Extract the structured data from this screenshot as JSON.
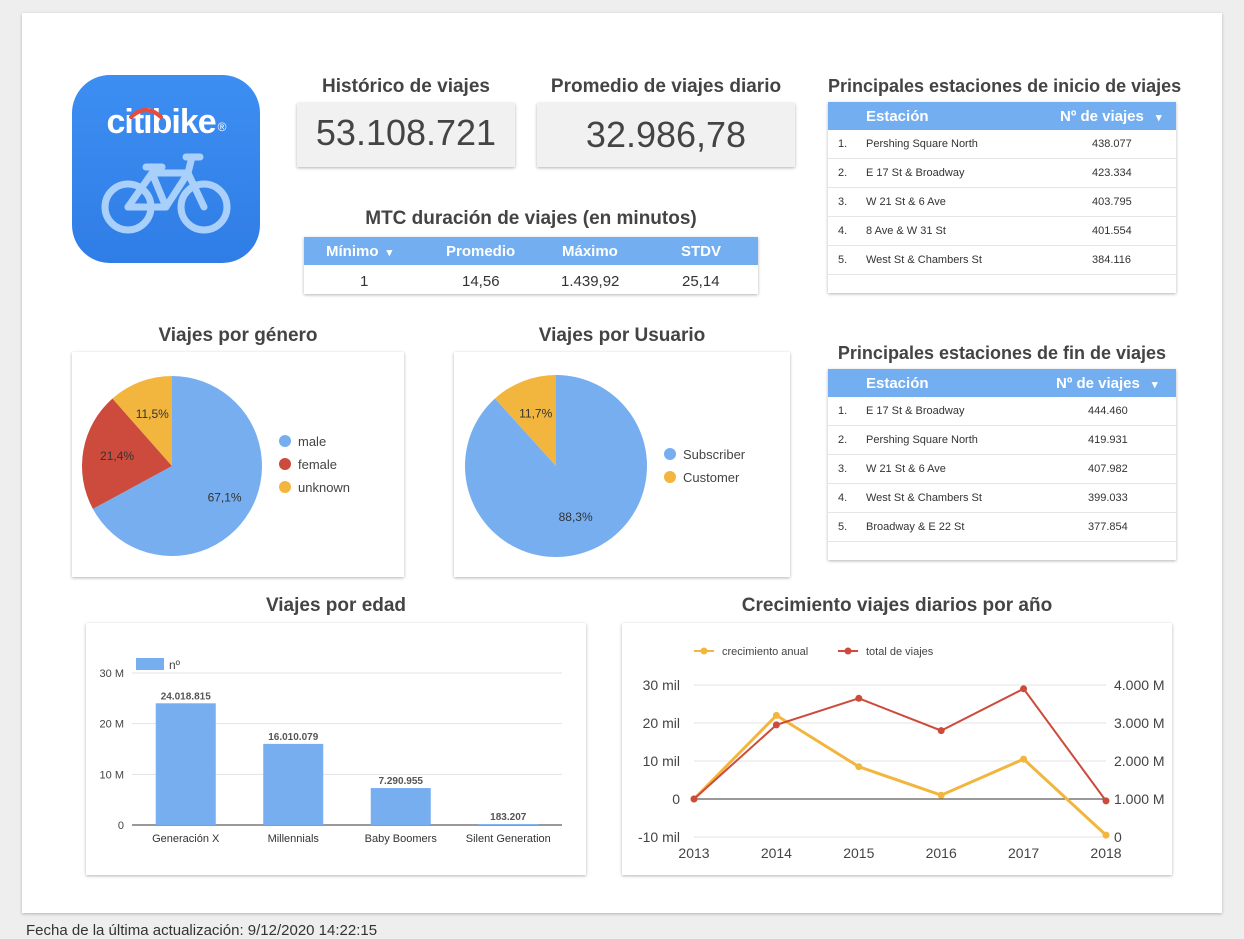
{
  "kpis": {
    "historico_title": "Histórico de viajes",
    "historico_value": "53.108.721",
    "promedio_title": "Promedio de viajes diario",
    "promedio_value": "32.986,78"
  },
  "logo": {
    "text_a": "citi",
    "text_b": "bike",
    "mark": "®"
  },
  "mtc": {
    "title": "MTC duración de viajes (en minutos)",
    "headers": [
      "Mínimo",
      "Promedio",
      "Máximo",
      "STDV"
    ],
    "sort_icon": "▾",
    "values": [
      "1",
      "14,56",
      "1.439,92",
      "25,14"
    ]
  },
  "inicio": {
    "title": "Principales estaciones de inicio de viajes",
    "col_station": "Estación",
    "col_trips": "Nº de viajes",
    "sort_icon": "▾",
    "rows": [
      {
        "rank": "1.",
        "station": "Pershing Square North",
        "trips": "438.077"
      },
      {
        "rank": "2.",
        "station": "E 17 St & Broadway",
        "trips": "423.334"
      },
      {
        "rank": "3.",
        "station": "W 21 St & 6 Ave",
        "trips": "403.795"
      },
      {
        "rank": "4.",
        "station": "8 Ave & W 31 St",
        "trips": "401.554"
      },
      {
        "rank": "5.",
        "station": "West St & Chambers St",
        "trips": "384.116"
      }
    ]
  },
  "fin": {
    "title": "Principales estaciones de fin de viajes",
    "col_station": "Estación",
    "col_trips": "Nº de viajes",
    "sort_icon": "▾",
    "rows": [
      {
        "rank": "1.",
        "station": "E 17 St & Broadway",
        "trips": "444.460"
      },
      {
        "rank": "2.",
        "station": "Pershing Square North",
        "trips": "419.931"
      },
      {
        "rank": "3.",
        "station": "W 21 St & 6 Ave",
        "trips": "407.982"
      },
      {
        "rank": "4.",
        "station": "West St & Chambers St",
        "trips": "399.033"
      },
      {
        "rank": "5.",
        "station": "Broadway & E 22 St",
        "trips": "377.854"
      }
    ]
  },
  "footer_text": "Fecha de la última actualización: 9/12/2020 14:22:15",
  "colors": {
    "blue": "#76aef0",
    "red": "#cc4b3c",
    "yellow": "#f2b63e",
    "header_blue": "#73aef0"
  },
  "chart_data": [
    {
      "type": "pie",
      "title": "Viajes por género",
      "labels": [
        "male",
        "female",
        "unknown"
      ],
      "values": [
        67.1,
        21.4,
        11.5
      ],
      "value_labels": [
        "67,1%",
        "21,4%",
        "11,5%"
      ],
      "colors": [
        "#76aef0",
        "#cc4b3c",
        "#f2b63e"
      ],
      "legend": "right"
    },
    {
      "type": "pie",
      "title": "Viajes por Usuario",
      "labels": [
        "Subscriber",
        "Customer"
      ],
      "values": [
        88.3,
        11.7
      ],
      "value_labels": [
        "88,3%",
        "11,7%"
      ],
      "colors": [
        "#76aef0",
        "#f2b63e"
      ],
      "legend": "right"
    },
    {
      "type": "bar",
      "title": "Viajes por edad",
      "categories": [
        "Generación X",
        "Millennials",
        "Baby Boomers",
        "Silent Generation"
      ],
      "series": [
        {
          "name": "nº",
          "values": [
            24018815,
            16010079,
            7290955,
            183207
          ]
        }
      ],
      "value_labels": [
        "24.018.815",
        "16.010.079",
        "7.290.955",
        "183.207"
      ],
      "ylim": [
        0,
        30000000
      ],
      "yticks": [
        0,
        10000000,
        20000000,
        30000000
      ],
      "ytick_labels": [
        "0",
        "10 M",
        "20 M",
        "30 M"
      ],
      "legend": "top-left",
      "grid": true
    },
    {
      "type": "line",
      "title": "Crecimiento viajes diarios por año",
      "x": [
        "2013",
        "2014",
        "2015",
        "2016",
        "2017",
        "2018"
      ],
      "series": [
        {
          "name": "crecimiento anual",
          "axis": "left",
          "color": "#f2b63e",
          "values": [
            0,
            22000,
            8500,
            1000,
            10500,
            -9500
          ]
        },
        {
          "name": "total de viajes",
          "axis": "right",
          "color": "#cc4b3c",
          "values": [
            1000000,
            2950000,
            3650000,
            2800000,
            3900000,
            950000
          ]
        }
      ],
      "ylim_left": [
        -10000,
        30000
      ],
      "yticks_left": [
        -10000,
        0,
        10000,
        20000,
        30000
      ],
      "ytick_labels_left": [
        "-10 mil",
        "0",
        "10 mil",
        "20 mil",
        "30 mil"
      ],
      "ylim_right": [
        0,
        4000000
      ],
      "yticks_right": [
        0,
        1000000,
        2000000,
        3000000,
        4000000
      ],
      "ytick_labels_right": [
        "0",
        "1.000 M",
        "2.000 M",
        "3.000 M",
        "4.000 M"
      ],
      "legend": "top-left",
      "grid": true
    }
  ]
}
